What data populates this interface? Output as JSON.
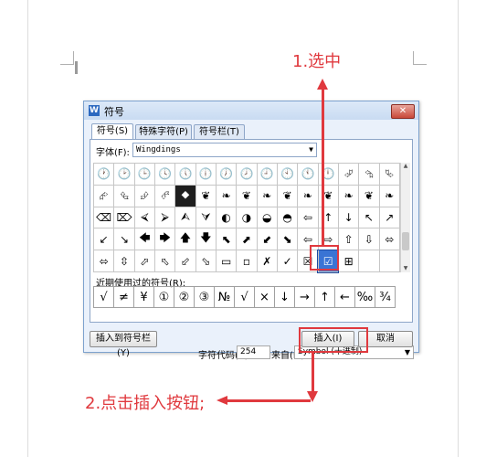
{
  "dialog": {
    "title": "符号",
    "close_label": "✕",
    "tabs": [
      {
        "label": "符号(S)"
      },
      {
        "label": "特殊字符(P)"
      },
      {
        "label": "符号栏(T)"
      }
    ],
    "font_label": "字体(F):",
    "font_value": "Wingdings",
    "grid": [
      [
        "🕐",
        "🕑",
        "🕒",
        "🕓",
        "🕔",
        "🕕",
        "🕖",
        "🕗",
        "🕘",
        "🕙",
        "🕚",
        "🕛",
        "⮰",
        "⮲",
        "⮱"
      ],
      [
        "⮳",
        "⮴",
        "⮵",
        "⮶",
        "⯁",
        "❦",
        "❧",
        "❦",
        "❧",
        "❦",
        "❧",
        "❦",
        "❧",
        "❦",
        "❧"
      ],
      [
        "⌫",
        "⌦",
        "⮘",
        "⮚",
        "⮙",
        "⮛",
        "◐",
        "◑",
        "◒",
        "◓",
        "⇦",
        "↑",
        "↓",
        "↖",
        "↗"
      ],
      [
        "↙",
        "↘",
        "🡄",
        "🡆",
        "🡅",
        "🡇",
        "⬉",
        "⬈",
        "⬋",
        "⬊",
        "⇦",
        "⇨",
        "⇧",
        "⇩",
        "⬄"
      ],
      [
        "⬄",
        "⇳",
        "⬀",
        "⬁",
        "⬃",
        "⬂",
        "▭",
        "▫",
        "✗",
        "✓",
        "☒",
        "☑",
        "⊞",
        "",
        ""
      ]
    ],
    "recent_label": "近期使用过的符号(R):",
    "recent": [
      "√",
      "≠",
      "¥",
      "①",
      "②",
      "③",
      "№",
      "√",
      "×",
      "↓",
      "→",
      "↑",
      "←",
      "‰",
      "¾"
    ],
    "code_label": "字符代码(C):",
    "code_value": "254",
    "from_label": "来自(M)",
    "from_value": "Symbol (十进制)",
    "insert_to_bar_label": "插入到符号栏(Y)",
    "insert_label": "插入(I)",
    "cancel_label": "取消"
  },
  "annotations": {
    "step1": "1.选中",
    "step2": "2.点击插入按钮;"
  },
  "colors": {
    "annotation_red": "#e0393e",
    "selection_blue": "#3a74d4"
  }
}
